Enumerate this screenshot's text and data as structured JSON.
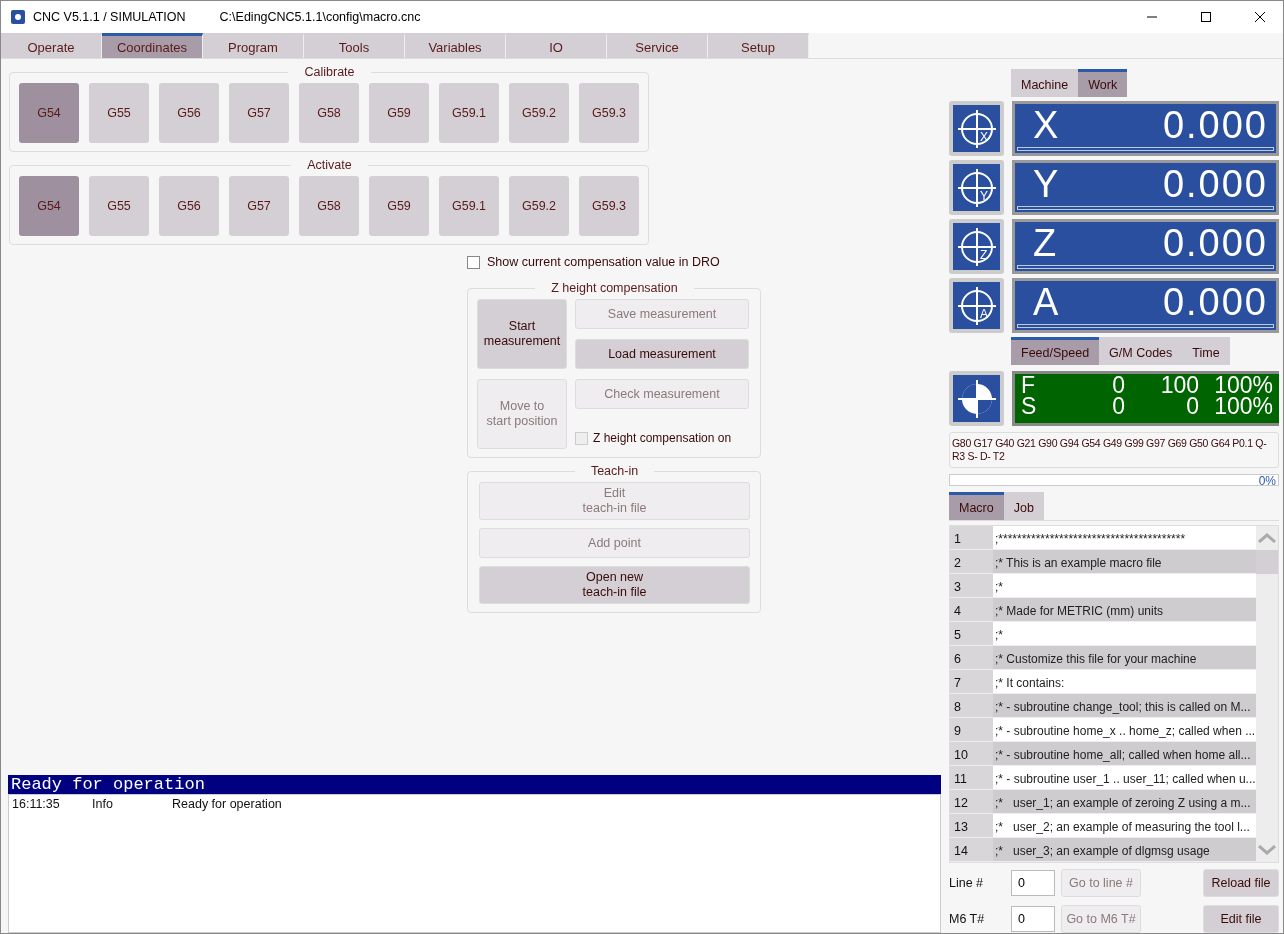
{
  "window": {
    "title": "CNC V5.1.1 / SIMULATION",
    "file": "C:\\EdingCNC5.1.1\\config\\macro.cnc"
  },
  "tabs": [
    {
      "label": "Operate",
      "selected": false
    },
    {
      "label": "Coordinates",
      "selected": true
    },
    {
      "label": "Program",
      "selected": false
    },
    {
      "label": "Tools",
      "selected": false
    },
    {
      "label": "Variables",
      "selected": false
    },
    {
      "label": "IO",
      "selected": false
    },
    {
      "label": "Service",
      "selected": false
    },
    {
      "label": "Setup",
      "selected": false
    }
  ],
  "calibrate": {
    "title": "Calibrate",
    "buttons": [
      {
        "label": "G54",
        "selected": true
      },
      {
        "label": "G55",
        "selected": false
      },
      {
        "label": "G56",
        "selected": false
      },
      {
        "label": "G57",
        "selected": false
      },
      {
        "label": "G58",
        "selected": false
      },
      {
        "label": "G59",
        "selected": false
      },
      {
        "label": "G59.1",
        "selected": false
      },
      {
        "label": "G59.2",
        "selected": false
      },
      {
        "label": "G59.3",
        "selected": false
      }
    ]
  },
  "activate": {
    "title": "Activate",
    "buttons": [
      {
        "label": "G54",
        "selected": true
      },
      {
        "label": "G55",
        "selected": false
      },
      {
        "label": "G56",
        "selected": false
      },
      {
        "label": "G57",
        "selected": false
      },
      {
        "label": "G58",
        "selected": false
      },
      {
        "label": "G59",
        "selected": false
      },
      {
        "label": "G59.1",
        "selected": false
      },
      {
        "label": "G59.2",
        "selected": false
      },
      {
        "label": "G59.3",
        "selected": false
      }
    ]
  },
  "show_compensation": {
    "label": "Show current compensation value in DRO",
    "checked": false
  },
  "z_height": {
    "title": "Z height compensation",
    "start": {
      "label": "Start\nmeasurement",
      "disabled": false
    },
    "move": {
      "label": "Move to\nstart position",
      "disabled": true
    },
    "save": {
      "label": "Save measurement",
      "disabled": true
    },
    "load": {
      "label": "Load measurement",
      "disabled": false
    },
    "check": {
      "label": "Check measurement",
      "disabled": true
    },
    "enable": {
      "label": "Z height compensation on",
      "checked": false,
      "disabled": true
    }
  },
  "teach_in": {
    "title": "Teach-in",
    "buttons": [
      {
        "label": "Edit\nteach-in file",
        "disabled": true
      },
      {
        "label": "Add point",
        "disabled": true
      },
      {
        "label": "Open new\nteach-in file",
        "disabled": false
      }
    ]
  },
  "status": {
    "banner": "Ready for operation",
    "log": [
      {
        "time": "16:11:35",
        "type": "Info",
        "message": "Ready for operation"
      }
    ]
  },
  "dro_tabs": [
    {
      "label": "Machine",
      "selected": false
    },
    {
      "label": "Work",
      "selected": true
    }
  ],
  "axes": [
    {
      "icon_label": "X",
      "axis": "X",
      "value": "0.000"
    },
    {
      "icon_label": "Y",
      "axis": "Y",
      "value": "0.000"
    },
    {
      "icon_label": "Z",
      "axis": "Z",
      "value": "0.000"
    },
    {
      "icon_label": "A",
      "axis": "A",
      "value": "0.000"
    }
  ],
  "info_tabs": [
    {
      "label": "Feed/Speed",
      "selected": true
    },
    {
      "label": "G/M Codes",
      "selected": false
    },
    {
      "label": "Time",
      "selected": false
    }
  ],
  "feed_speed": [
    {
      "name": "F",
      "actual": "0",
      "set": "100",
      "override": "100%"
    },
    {
      "name": "S",
      "actual": "0",
      "set": "0",
      "override": "100%"
    }
  ],
  "gcodes": "G80 G17 G40 G21 G90 G94 G54 G49 G99 G97 G69 G50 G64 P0.1 Q- R3 S- D- T2",
  "progress": {
    "level": 0,
    "reading": "0%"
  },
  "file_tabs": [
    {
      "label": "Macro",
      "selected": true
    },
    {
      "label": "Job",
      "selected": false
    }
  ],
  "macro_lines": [
    {
      "number": "1",
      "text": ";****************************************"
    },
    {
      "number": "2",
      "text": ";* This is an example macro file"
    },
    {
      "number": "3",
      "text": ";*"
    },
    {
      "number": "4",
      "text": ";* Made for METRIC (mm) units"
    },
    {
      "number": "5",
      "text": ";*"
    },
    {
      "number": "6",
      "text": ";* Customize this file for your machine"
    },
    {
      "number": "7",
      "text": ";* It contains:"
    },
    {
      "number": "8",
      "text": ";* - subroutine change_tool; this is called on M..."
    },
    {
      "number": "9",
      "text": ";* - subroutine home_x .. home_z; called when ..."
    },
    {
      "number": "10",
      "text": ";* - subroutine home_all; called when home all..."
    },
    {
      "number": "11",
      "text": ";* - subroutine user_1 .. user_11; called when u..."
    },
    {
      "number": "12",
      "text": ";*   user_1; an example of zeroing Z using a m..."
    },
    {
      "number": "13",
      "text": ";*   user_2; an example of measuring the tool l..."
    },
    {
      "number": "14",
      "text": ";*   user_3; an example of dlgmsg usage"
    }
  ],
  "line_goto": {
    "label": "Line #",
    "value": "0",
    "button": "Go to line #",
    "disabled": true
  },
  "m6_goto": {
    "label": "M6 T#",
    "value": "0",
    "button": "Go to M6 T#",
    "disabled": true
  },
  "reload_button": "Reload file",
  "edit_button": "Edit file"
}
